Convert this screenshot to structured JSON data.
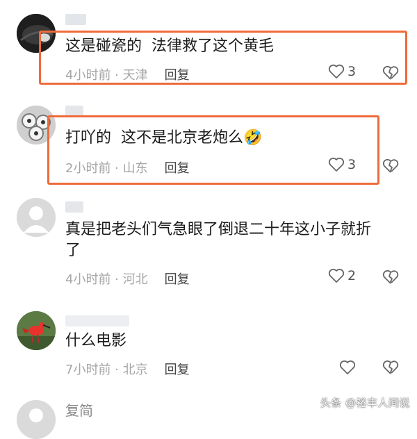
{
  "comments": [
    {
      "text": "这是碰瓷的  法律救了这个黄毛",
      "time": "4小时前 · 天津",
      "reply": "回复",
      "likes": "3"
    },
    {
      "text": "打吖的  这不是北京老炮么🤣",
      "time": "2小时前 · 山东",
      "reply": "回复",
      "likes": "3"
    },
    {
      "text": "真是把老头们气急眼了倒退二十年这小子就折\n了",
      "time": "4小时前 · 河北",
      "reply": "回复",
      "likes": "2"
    },
    {
      "text": "什么电影",
      "time": "7小时前 · 北京",
      "reply": "回复",
      "likes": ""
    },
    {
      "username": "复简"
    }
  ],
  "watermark": "头条 @裕丰人间说",
  "colors": {
    "highlight_box": "#ef6a3b",
    "meta_text": "#a5a5a5",
    "body_text": "#1b1b1b"
  }
}
